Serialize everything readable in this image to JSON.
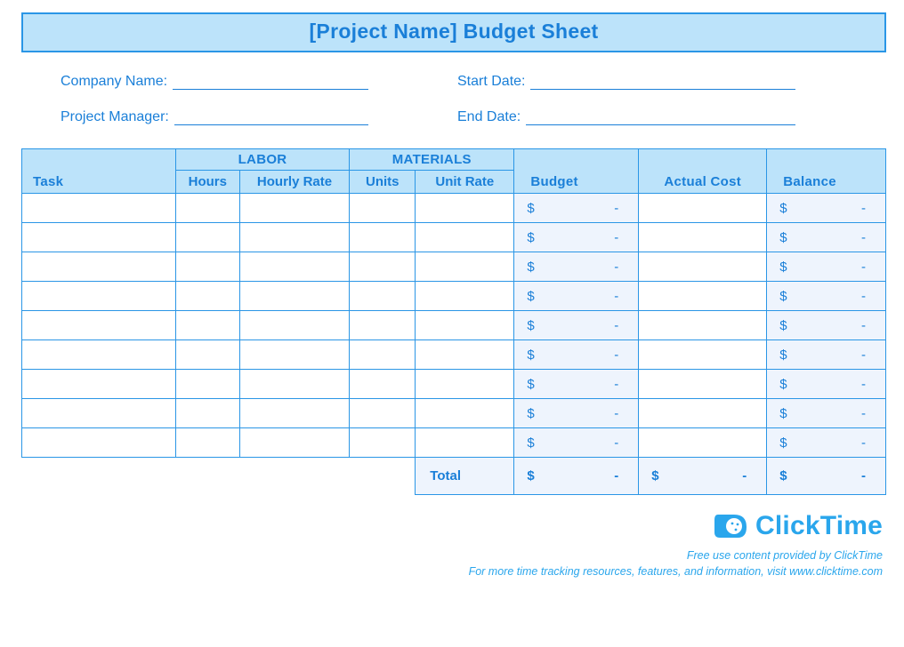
{
  "title": "[Project Name] Budget Sheet",
  "meta": {
    "company_label": "Company Name:",
    "manager_label": "Project Manager:",
    "start_label": "Start Date:",
    "end_label": "End Date:",
    "company_value": "",
    "manager_value": "",
    "start_value": "",
    "end_value": ""
  },
  "headers": {
    "task": "Task",
    "labor_group": "LABOR",
    "materials_group": "MATERIALS",
    "hours": "Hours",
    "hourly_rate": "Hourly Rate",
    "units": "Units",
    "unit_rate": "Unit Rate",
    "budget": "Budget",
    "actual": "Actual Cost",
    "balance": "Balance"
  },
  "currency_symbol": "$",
  "dash": "-",
  "rows": [
    {
      "task": "",
      "hours": "",
      "hourly_rate": "",
      "units": "",
      "unit_rate": "",
      "budget": "-",
      "actual": "",
      "balance": "-"
    },
    {
      "task": "",
      "hours": "",
      "hourly_rate": "",
      "units": "",
      "unit_rate": "",
      "budget": "-",
      "actual": "",
      "balance": "-"
    },
    {
      "task": "",
      "hours": "",
      "hourly_rate": "",
      "units": "",
      "unit_rate": "",
      "budget": "-",
      "actual": "",
      "balance": "-"
    },
    {
      "task": "",
      "hours": "",
      "hourly_rate": "",
      "units": "",
      "unit_rate": "",
      "budget": "-",
      "actual": "",
      "balance": "-"
    },
    {
      "task": "",
      "hours": "",
      "hourly_rate": "",
      "units": "",
      "unit_rate": "",
      "budget": "-",
      "actual": "",
      "balance": "-"
    },
    {
      "task": "",
      "hours": "",
      "hourly_rate": "",
      "units": "",
      "unit_rate": "",
      "budget": "-",
      "actual": "",
      "balance": "-"
    },
    {
      "task": "",
      "hours": "",
      "hourly_rate": "",
      "units": "",
      "unit_rate": "",
      "budget": "-",
      "actual": "",
      "balance": "-"
    },
    {
      "task": "",
      "hours": "",
      "hourly_rate": "",
      "units": "",
      "unit_rate": "",
      "budget": "-",
      "actual": "",
      "balance": "-"
    },
    {
      "task": "",
      "hours": "",
      "hourly_rate": "",
      "units": "",
      "unit_rate": "",
      "budget": "-",
      "actual": "",
      "balance": "-"
    }
  ],
  "totals": {
    "label": "Total",
    "budget": "-",
    "actual": "-",
    "balance": "-"
  },
  "footer": {
    "brand": "ClickTime",
    "line1": "Free use content provided by ClickTime",
    "line2": "For more time tracking resources, features, and information, visit www.clicktime.com"
  }
}
